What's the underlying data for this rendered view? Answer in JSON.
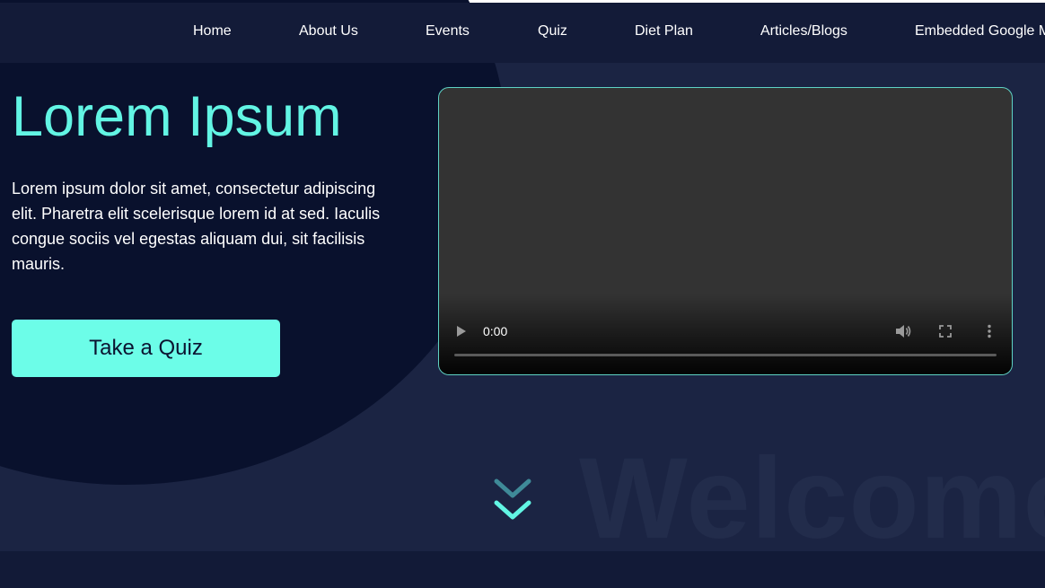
{
  "nav": {
    "items": [
      {
        "label": "Home"
      },
      {
        "label": "About Us"
      },
      {
        "label": "Events"
      },
      {
        "label": "Quiz"
      },
      {
        "label": "Diet Plan"
      },
      {
        "label": "Articles/Blogs"
      },
      {
        "label": "Embedded Google M"
      }
    ]
  },
  "hero": {
    "title": "Lorem Ipsum",
    "description": "Lorem ipsum dolor sit amet, consectetur adipiscing elit. Pharetra elit scelerisque lorem id at sed. Iaculis congue sociis vel egestas aliquam dui, sit facilisis mauris.",
    "cta_label": "Take a Quiz"
  },
  "video": {
    "current_time": "0:00",
    "progress": 0,
    "icons": {
      "play": "play-icon",
      "volume": "volume-icon",
      "fullscreen": "fullscreen-icon",
      "more": "more-vertical-icon"
    }
  },
  "welcome": {
    "watermark": "Welcome"
  },
  "scroll": {
    "icon": "double-chevron-down-icon"
  },
  "colors": {
    "accent": "#6cfde8",
    "title": "#62f5e4",
    "nav_bg": "#131b38",
    "page_bg": "#1b2443",
    "circle_bg": "#09112d"
  }
}
